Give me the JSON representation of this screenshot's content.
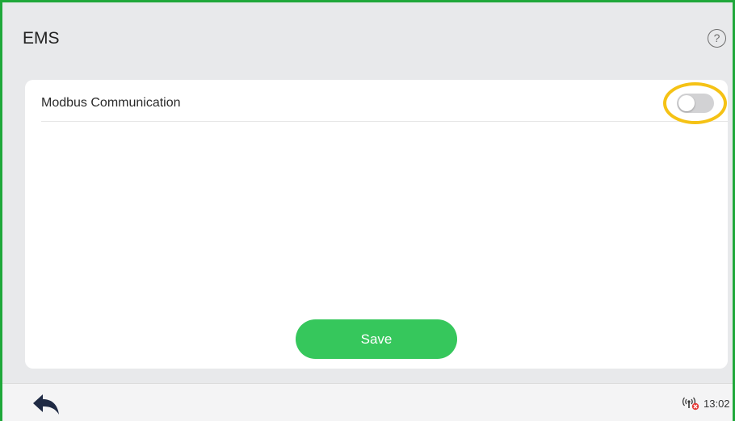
{
  "header": {
    "title": "EMS",
    "help_symbol": "?"
  },
  "settings": {
    "rows": [
      {
        "label": "Modbus Communication",
        "toggle_on": false
      }
    ],
    "save_label": "Save"
  },
  "status_bar": {
    "time": "13:02",
    "back_icon": "reply-arrow-icon",
    "signal_icon": "signal-disconnected-icon"
  },
  "colors": {
    "frame_border": "#1fa83a",
    "save_button": "#36c75c",
    "highlight": "#f5c215",
    "toggle_off": "#d2d2d4"
  }
}
